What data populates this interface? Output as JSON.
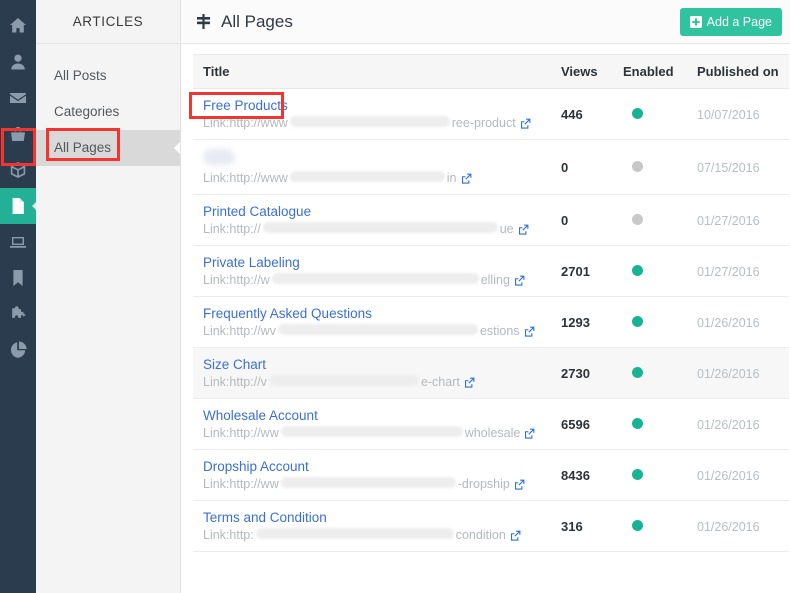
{
  "rail": {
    "items": [
      {
        "name": "home-icon",
        "label": "Dashboard",
        "active": false
      },
      {
        "name": "user-icon",
        "label": "Customers",
        "active": false
      },
      {
        "name": "envelope-icon",
        "label": "Messages",
        "active": false
      },
      {
        "name": "bag-icon",
        "label": "Orders",
        "active": false
      },
      {
        "name": "box-icon",
        "label": "Products",
        "active": false
      },
      {
        "name": "file-icon",
        "label": "Articles",
        "active": true
      },
      {
        "name": "laptop-icon",
        "label": "Design",
        "active": false
      },
      {
        "name": "bookmark-icon",
        "label": "Marketing",
        "active": false
      },
      {
        "name": "puzzle-icon",
        "label": "Apps",
        "active": false
      },
      {
        "name": "pie-chart-icon",
        "label": "Reports",
        "active": false
      }
    ]
  },
  "sidebar": {
    "heading": "ARTICLES",
    "items": [
      {
        "label": "All Posts",
        "selected": false
      },
      {
        "label": "Categories",
        "selected": false
      },
      {
        "label": "All Pages",
        "selected": true
      }
    ]
  },
  "topbar": {
    "icon": "signpost-icon",
    "title": "All Pages",
    "add_button": {
      "label": "Add a Page",
      "icon": "plus-square-icon",
      "color": "#2fc39f"
    }
  },
  "table": {
    "columns": [
      "Title",
      "Views",
      "Enabled",
      "Published on"
    ],
    "link_prefix": "Link: ",
    "rows": [
      {
        "title": "Free Products",
        "title_redacted": false,
        "url_prefix": "http://www",
        "url_suffix": "ree-product",
        "mask_width": 160,
        "views": "446",
        "enabled": true,
        "published_on": "10/07/2016",
        "hovered": false
      },
      {
        "title": "",
        "title_redacted": true,
        "url_prefix": "http://www",
        "url_suffix": "in",
        "mask_width": 155,
        "views": "0",
        "enabled": false,
        "published_on": "07/15/2016",
        "hovered": false
      },
      {
        "title": "Printed Catalogue",
        "title_redacted": false,
        "url_prefix": "http://",
        "url_suffix": "ue",
        "mask_width": 235,
        "views": "0",
        "enabled": false,
        "published_on": "01/27/2016",
        "hovered": false
      },
      {
        "title": "Private Labeling",
        "title_redacted": false,
        "url_prefix": "http://w",
        "url_suffix": "elling",
        "mask_width": 207,
        "views": "2701",
        "enabled": true,
        "published_on": "01/27/2016",
        "hovered": false
      },
      {
        "title": "Frequently Asked Questions",
        "title_redacted": false,
        "url_prefix": "http://wv",
        "url_suffix": "estions",
        "mask_width": 200,
        "views": "1293",
        "enabled": true,
        "published_on": "01/26/2016",
        "hovered": false
      },
      {
        "title": "Size Chart",
        "title_redacted": false,
        "url_prefix": "http://v",
        "url_suffix": "e-chart",
        "mask_width": 150,
        "views": "2730",
        "enabled": true,
        "published_on": "01/26/2016",
        "hovered": true
      },
      {
        "title": "Wholesale Account",
        "title_redacted": false,
        "url_prefix": "http://ww",
        "url_suffix": "wholesale",
        "mask_width": 182,
        "views": "6596",
        "enabled": true,
        "published_on": "01/26/2016",
        "hovered": false
      },
      {
        "title": "Dropship Account",
        "title_redacted": false,
        "url_prefix": "http://ww",
        "url_suffix": "-dropship",
        "mask_width": 175,
        "views": "8436",
        "enabled": true,
        "published_on": "01/26/2016",
        "hovered": false
      },
      {
        "title": "Terms and Condition",
        "title_redacted": false,
        "url_prefix": "http:",
        "url_suffix": " condition",
        "mask_width": 198,
        "views": "316",
        "enabled": true,
        "published_on": "01/26/2016",
        "hovered": false
      }
    ]
  },
  "annotations": {
    "color": "#f4352f",
    "boxes": [
      {
        "name": "rail-articles-icon-highlight"
      },
      {
        "name": "sidebar-all-pages-highlight"
      },
      {
        "name": "free-products-link-highlight"
      }
    ]
  }
}
